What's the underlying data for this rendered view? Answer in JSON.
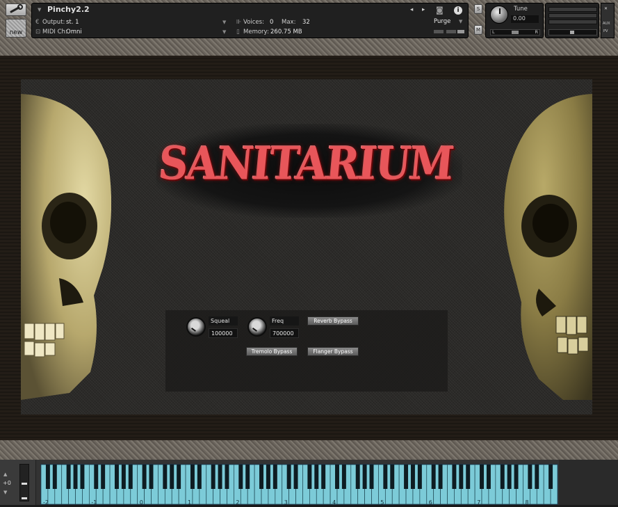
{
  "header": {
    "instrument_name": "Pinchy2.2",
    "output_label": "Output:",
    "output_value": "st. 1",
    "midi_label": "MIDI Ch:",
    "midi_value": "Omni",
    "voices_label": "Voices:",
    "voices_value": "0",
    "max_label": "Max:",
    "max_value": "32",
    "memory_label": "Memory:",
    "memory_value": "260.75 MB",
    "purge_label": "Purge",
    "new_label": "new",
    "solo_label": "S",
    "mute_label": "M",
    "tune_label": "Tune",
    "tune_value": "0.00",
    "pan_left": "L",
    "pan_right": "R",
    "aux_label": "AUX",
    "pv_label": "PV"
  },
  "logo_text": "SANITARIUM",
  "controls": {
    "squeal_label": "Squeal",
    "squeal_value": "100000",
    "freq_label": "Freq",
    "freq_value": "700000",
    "reverb_bypass": "Reverb Bypass",
    "tremolo_bypass": "Tremolo Bypass",
    "flanger_bypass": "Flanger Bypass"
  },
  "keyboard": {
    "octave_value": "+0",
    "octave_labels": [
      "-2",
      "-1",
      "0",
      "1",
      "2",
      "3",
      "4",
      "5",
      "6",
      "7",
      "8"
    ]
  },
  "colors": {
    "logo_red": "#e8565a",
    "keyboard_cyan": "#7ccbd8",
    "panel_dark": "#202020"
  }
}
